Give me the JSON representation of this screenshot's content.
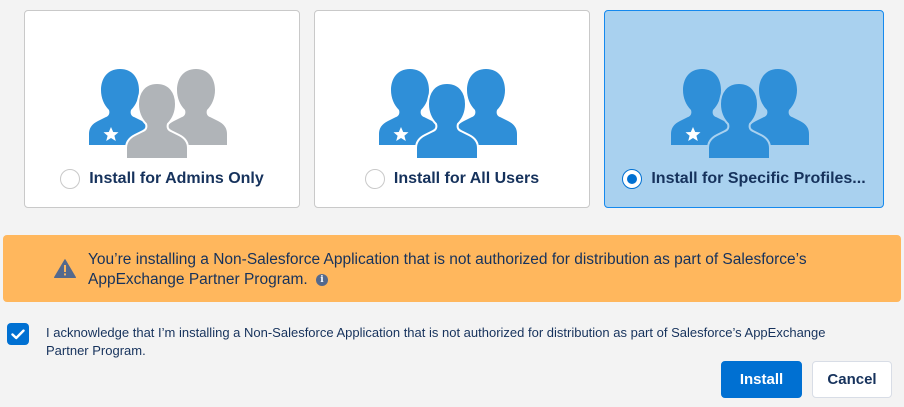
{
  "options": [
    {
      "label": "Install for Admins Only",
      "selected": false,
      "icon": "admins-users-icon"
    },
    {
      "label": "Install for All Users",
      "selected": false,
      "icon": "all-users-icon"
    },
    {
      "label": "Install for Specific Profiles...",
      "selected": true,
      "icon": "specific-profiles-users-icon"
    }
  ],
  "warning": {
    "text": "You’re installing a Non-Salesforce Application that is not authorized for distribution as part of Salesforce’s AppExchange Partner Program.",
    "icon": "warning-icon",
    "info_icon": "info-icon",
    "info_glyph": "i"
  },
  "acknowledge": {
    "checked": true,
    "text": "I acknowledge that I’m installing a Non-Salesforce Application that is not authorized for distribution as part of Salesforce’s AppExchange Partner Program."
  },
  "buttons": {
    "install": "Install",
    "cancel": "Cancel"
  },
  "colors": {
    "accent": "#0070d2",
    "icon_blue": "#2f8fd8",
    "icon_gray": "#b0b4b8",
    "selected_card": "#a9d1ef",
    "warning_bg": "#ffb75d",
    "text": "#16325c"
  }
}
